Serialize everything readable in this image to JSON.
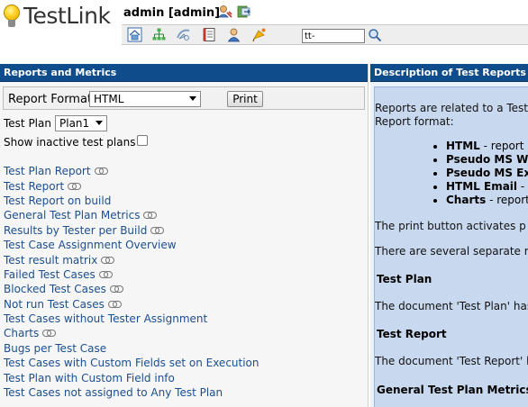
{
  "app": {
    "logo_text": "TestLink",
    "user_label": "admin [admin]"
  },
  "toolbar": {
    "search_value": "tt-"
  },
  "left_pane": {
    "title": "Reports and Metrics",
    "report_format_label": "Report Format",
    "report_format_value": "HTML",
    "print_label": "Print",
    "test_plan_label": "Test Plan",
    "test_plan_value": "Plan1",
    "show_inactive_label": "Show inactive test plans",
    "reports": [
      {
        "label": "Test Plan Report",
        "link": true
      },
      {
        "label": "Test Report",
        "link": true
      },
      {
        "label": "Test Report on build",
        "link": false
      },
      {
        "label": "General Test Plan Metrics",
        "link": true
      },
      {
        "label": "Results by Tester per Build",
        "link": true
      },
      {
        "label": "Test Case Assignment Overview",
        "link": false
      },
      {
        "label": "Test result matrix",
        "link": true
      },
      {
        "label": "Failed Test Cases",
        "link": true
      },
      {
        "label": "Blocked Test Cases",
        "link": true
      },
      {
        "label": "Not run Test Cases",
        "link": true
      },
      {
        "label": "Test Cases without Tester Assignment",
        "link": false
      },
      {
        "label": "Charts",
        "link": true
      },
      {
        "label": "Bugs per Test Case",
        "link": false
      },
      {
        "label": "Test Cases with Custom Fields set on Execution",
        "link": false
      },
      {
        "label": "Test Plan with Custom Field info",
        "link": false
      },
      {
        "label": "Test Cases not assigned to Any Test Plan",
        "link": false
      }
    ]
  },
  "right_pane": {
    "title": "Description of Test Reports and M",
    "intro_line1": "Reports are related to a Test",
    "intro_line2": "Report format:",
    "bullets": [
      {
        "bold": "HTML",
        "rest": " - report"
      },
      {
        "bold": "Pseudo MS Wo",
        "rest": ""
      },
      {
        "bold": "Pseudo MS Exc",
        "rest": ""
      },
      {
        "bold": "HTML Email",
        "rest": " - r"
      },
      {
        "bold": "Charts",
        "rest": " - report"
      }
    ],
    "print_text": "The print button activates p",
    "separate_text": "There are several separate r",
    "heading_test_plan": "Test Plan",
    "test_plan_text": "The document 'Test Plan' has",
    "heading_test_report": "Test Report",
    "test_report_text": "The document 'Test Report' h",
    "heading_general": "General Test Plan Metrics"
  },
  "colors": {
    "title_bar": "#0f4c8c",
    "link": "#1c4f8f",
    "desc_bg": "#c8d9ef"
  }
}
